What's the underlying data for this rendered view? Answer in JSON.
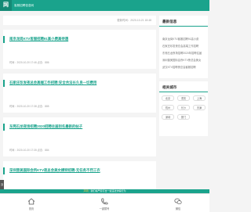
{
  "header": {
    "logo": "网",
    "site_name": "客服招聘信息网"
  },
  "list": {
    "label": "",
    "updated": "更新时间：2020-10-21 18:48"
  },
  "posts": [
    {
      "title": "南京龙岗KTV客服招聘91高小费高待遇",
      "meta": "时间：2020-10-20 17:46 点击：886"
    },
    {
      "title": "石家庄珍发夜总会高端工作招聘:安全合法长久良一切费用",
      "meta": "时间：2020-10-20 17:38 点击：885"
    },
    {
      "title": "东莞石龙夜场招聘2020招聘往届别名最新的帖子",
      "meta": "时间：2020-10-20 17:35 点击：884"
    },
    {
      "title": "深圳普美国际会所KTV夜总会美女模特招聘-无任务不罚工衣",
      "meta": "时间：2020-10-20 17:32 点击：883"
    }
  ],
  "sidebar": {
    "latest_title": "最新信息",
    "latest": [
      "南京龙岗KTV客服招聘91高小费",
      "石家庄珍发夜总会高端工作招聘",
      "东莞石龙夜场招聘2020年招聘往届",
      "深圳普美国际会所KTV夜总会美女",
      "武汉KTV招聘夜总会客服招聘"
    ],
    "cities_title": "相关城市",
    "cities": [
      "北京",
      "重庆",
      "上海",
      "杭州",
      "长沙",
      "天津",
      "深圳",
      "厦门"
    ]
  },
  "footer": {
    "prefix": "声明：",
    "text": "我们将严厉打击一些违法诈骗行为"
  },
  "tabs": [
    {
      "label": "首页"
    },
    {
      "label": "一键拨号"
    },
    {
      "label": "微信"
    }
  ],
  "fab_label": "顶",
  "colors": {
    "accent": "#1aa38c",
    "highlight": "#ffd24d"
  }
}
